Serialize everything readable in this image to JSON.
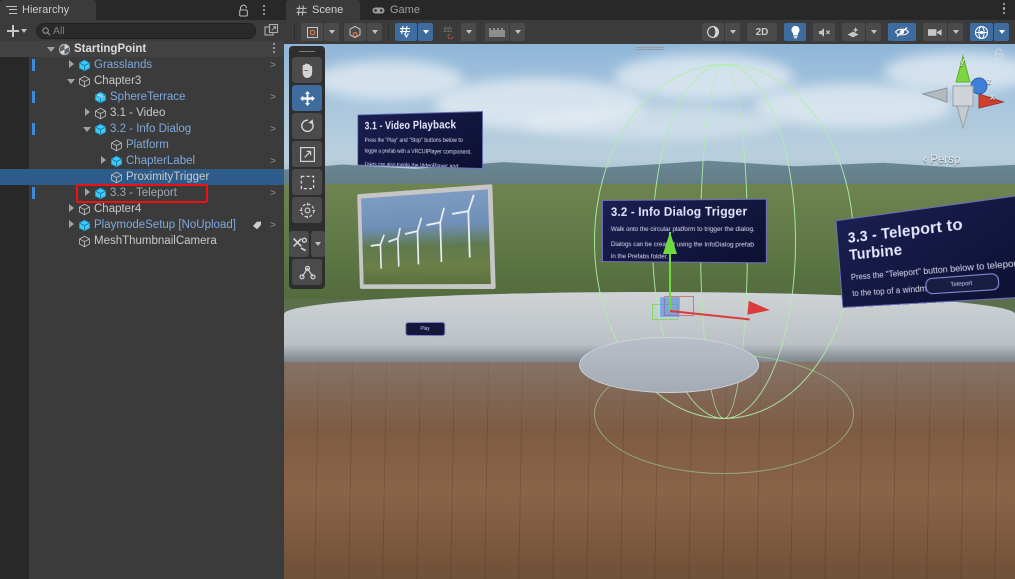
{
  "hierarchy": {
    "tab_label": "Hierarchy",
    "lock_icon": "lock-icon",
    "menu_icon": "kebab-menu-icon",
    "add_label": "+",
    "search": {
      "placeholder": "All",
      "value": "",
      "icon": "search-icon"
    },
    "popout_icon": "popout-icon",
    "scene_root": "StartingPoint",
    "items": [
      {
        "label": "Grasslands",
        "indent": 2,
        "twirl": "closed",
        "icon": "prefab-cube-icon",
        "style": "blue",
        "chevron": ">",
        "mark": true,
        "selected": false
      },
      {
        "label": "Chapter3",
        "indent": 2,
        "twirl": "open",
        "icon": "gameobject-cube-icon",
        "style": "plain",
        "chevron": "",
        "mark": false,
        "selected": false
      },
      {
        "label": "SphereTerrace",
        "indent": 3,
        "twirl": "none",
        "icon": "mesh-icon",
        "style": "blue",
        "chevron": ">",
        "mark": true,
        "selected": false
      },
      {
        "label": "3.1 - Video",
        "indent": 3,
        "twirl": "closed",
        "icon": "gameobject-cube-icon",
        "style": "plain",
        "chevron": "",
        "mark": false,
        "selected": false
      },
      {
        "label": "3.2 - Info Dialog",
        "indent": 3,
        "twirl": "open",
        "icon": "prefab-cube-icon",
        "style": "blue",
        "chevron": ">",
        "mark": true,
        "selected": false
      },
      {
        "label": "Platform",
        "indent": 4,
        "twirl": "none",
        "icon": "gameobject-cube-icon",
        "style": "blue",
        "chevron": "",
        "mark": false,
        "selected": false
      },
      {
        "label": "ChapterLabel",
        "indent": 4,
        "twirl": "closed",
        "icon": "prefab-cube-icon",
        "style": "blue",
        "chevron": ">",
        "mark": false,
        "selected": false
      },
      {
        "label": "ProximityTrigger",
        "indent": 4,
        "twirl": "none",
        "icon": "gameobject-cube-icon",
        "style": "plain",
        "chevron": "",
        "mark": false,
        "selected": true
      },
      {
        "label": "3.3 - Teleport",
        "indent": 3,
        "twirl": "closed",
        "icon": "prefab-cube-icon",
        "style": "dim",
        "chevron": ">",
        "mark": true,
        "selected": false
      },
      {
        "label": "Chapter4",
        "indent": 2,
        "twirl": "closed",
        "icon": "gameobject-cube-icon",
        "style": "plain",
        "chevron": "",
        "mark": false,
        "selected": false
      },
      {
        "label": "PlaymodeSetup [NoUpload]",
        "indent": 2,
        "twirl": "closed",
        "icon": "prefab-cube-icon",
        "style": "blue",
        "chevron": ">",
        "mark": false,
        "selected": false,
        "tag": true
      },
      {
        "label": "MeshThumbnailCamera",
        "indent": 2,
        "twirl": "none",
        "icon": "gameobject-cube-icon",
        "style": "plain",
        "chevron": "",
        "mark": false,
        "selected": false
      }
    ],
    "annotation": {
      "target": "ProximityTrigger",
      "color": "#ee1111"
    }
  },
  "scene_panel": {
    "tabs": [
      {
        "label": "Scene",
        "icon": "grid-icon",
        "active": true
      },
      {
        "label": "Game",
        "icon": "gamepad-icon",
        "active": false
      }
    ],
    "menu_icon": "kebab-menu-icon",
    "toolbar_left": [
      {
        "name": "pivot-mode-button",
        "label": "Center",
        "icon": "pivot-center-icon",
        "active": false,
        "dropdown": true
      },
      {
        "name": "handle-space-button",
        "label": "Global",
        "icon": "global-space-icon",
        "active": false,
        "dropdown": true
      },
      {
        "name": "grid-visibility-button",
        "label": "Grid",
        "icon": "grid-axis-icon",
        "active": true,
        "dropdown": true
      },
      {
        "name": "grid-snap-button",
        "label": "Snap",
        "icon": "grid-snap-icon",
        "active": false,
        "dropdown": true,
        "disabled": true
      },
      {
        "name": "increment-snap-button",
        "label": "Ruler",
        "icon": "ruler-icon",
        "active": false,
        "dropdown": true
      }
    ],
    "toolbar_right": [
      {
        "name": "shading-mode-button",
        "label": "Shaded",
        "icon": "shading-sphere-icon",
        "active": false,
        "dropdown": true
      },
      {
        "name": "2d-toggle-button",
        "label": "2D",
        "icon": "",
        "active": false,
        "dropdown": false
      },
      {
        "name": "lighting-toggle-button",
        "label": "Light",
        "icon": "lightbulb-icon",
        "active": true,
        "dropdown": false
      },
      {
        "name": "audio-toggle-button",
        "label": "Audio",
        "icon": "audio-muted-icon",
        "active": false,
        "dropdown": false
      },
      {
        "name": "effects-toggle-button",
        "label": "Effects",
        "icon": "fx-icon",
        "active": false,
        "dropdown": true
      },
      {
        "name": "hidden-objects-button",
        "label": "Hidden",
        "icon": "eye-slash-icon",
        "active": true,
        "dropdown": false
      },
      {
        "name": "camera-settings-button",
        "label": "Camera",
        "icon": "camera-icon",
        "active": false,
        "dropdown": true
      },
      {
        "name": "gizmos-toggle-button",
        "label": "Gizmos",
        "icon": "gizmo-globe-icon",
        "active": true,
        "dropdown": true
      }
    ]
  },
  "tool_palette": {
    "tools": [
      {
        "name": "hand-tool",
        "icon": "hand-icon",
        "active": false
      },
      {
        "name": "move-tool",
        "icon": "move-icon",
        "active": true
      },
      {
        "name": "rotate-tool",
        "icon": "rotate-icon",
        "active": false
      },
      {
        "name": "scale-tool",
        "icon": "scale-icon",
        "active": false
      },
      {
        "name": "rect-tool",
        "icon": "rect-icon",
        "active": false
      },
      {
        "name": "transform-tool",
        "icon": "transform-icon",
        "active": false
      }
    ],
    "custom_tools": {
      "name": "custom-editor-tools",
      "icon": "wrench-icon"
    },
    "component_tools": {
      "name": "component-tools",
      "icon": "joint-icon"
    }
  },
  "viewport": {
    "view_gizmo": {
      "mode_label": "Persp",
      "axis_labels": {
        "x": "x",
        "y": "y",
        "z": "z"
      },
      "lock_icon": "lock-icon"
    },
    "gizmo": {
      "type": "move-gizmo",
      "axis_colors": {
        "x": "#db3b3b",
        "y": "#6ddb3f",
        "z": "#4682dc"
      }
    },
    "collider_wire_color": "#aef0a8",
    "panels": [
      {
        "name": "video-playback-panel",
        "title": "3.1 - Video Playback",
        "lines": [
          "Press the \"Play\" and \"Stop\" buttons below to toggle a prefab with a VRCUIPlayer component.",
          "Users can also toggle the VideoPlayer and change the video feed."
        ]
      },
      {
        "name": "info-dialog-trigger-panel",
        "title": "3.2 - Info Dialog Trigger",
        "lines": [
          "Walk onto the circular platform to trigger the dialog.",
          "Dialogs can be created using the InfoDialog prefab in the Prefabs folder."
        ]
      },
      {
        "name": "teleport-panel",
        "title": "3.3 - Teleport to Turbine",
        "lines": [
          "Press the \"Teleport\" button below to teleport to the top of a windmill and continue."
        ],
        "button_label": "Teleport"
      }
    ],
    "video_screen": {
      "name": "video-screen",
      "content": "wind-turbines"
    },
    "play_button_label": "Play",
    "platform": {
      "name": "circular-platform"
    }
  }
}
